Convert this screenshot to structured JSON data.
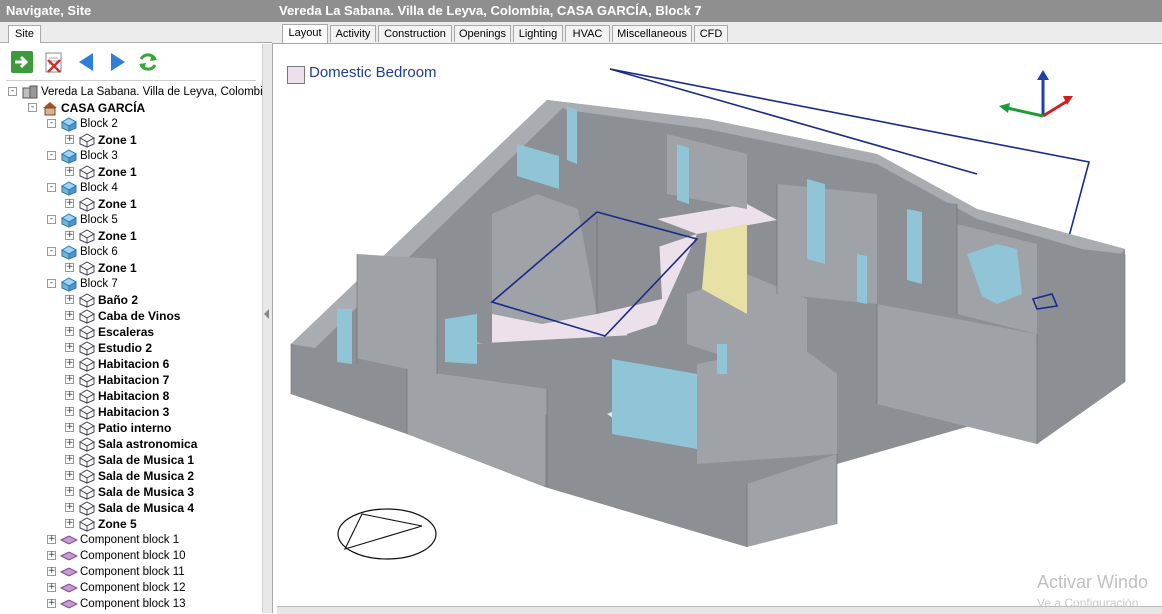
{
  "left_panel": {
    "title": "Navigate, Site",
    "tab": "Site",
    "toolbar": [
      {
        "name": "go-icon",
        "color": "#3c9a3c"
      },
      {
        "name": "delete-icon",
        "color": "#c0392b"
      },
      {
        "name": "back-arrow-icon",
        "color": "#2f7fd6"
      },
      {
        "name": "forward-arrow-icon",
        "color": "#2f7fd6"
      },
      {
        "name": "refresh-icon",
        "color": "#3aa53a"
      }
    ],
    "tree": {
      "site": "Vereda La Sabana. Villa de Leyva, Colombia",
      "building": "CASA GARCÍA",
      "blocks": [
        {
          "label": "Block 2",
          "zones": [
            "Zone 1"
          ]
        },
        {
          "label": "Block 3",
          "zones": [
            "Zone 1"
          ]
        },
        {
          "label": "Block 4",
          "zones": [
            "Zone 1"
          ]
        },
        {
          "label": "Block 5",
          "zones": [
            "Zone 1"
          ]
        },
        {
          "label": "Block 6",
          "zones": [
            "Zone 1"
          ]
        },
        {
          "label": "Block 7",
          "zones": [
            "Baño 2",
            "Caba de Vinos",
            "Escaleras",
            "Estudio 2",
            "Habitacion  6",
            "Habitacion  7",
            "Habitacion  8",
            "Habitacion 3",
            "Patio interno",
            "Sala astronomica",
            "Sala de Musica  1",
            "Sala de Musica  2",
            "Sala de Musica  3",
            "Sala de Musica  4",
            "Zone 5"
          ]
        }
      ],
      "component_blocks": [
        "Component block 1",
        "Component block 10",
        "Component block 11",
        "Component block 12",
        "Component block 13"
      ]
    }
  },
  "main": {
    "title": "Vereda La Sabana. Villa de Leyva, Colombia, CASA GARCÍA, Block 7",
    "tabs": [
      "Layout",
      "Activity",
      "Construction",
      "Openings",
      "Lighting",
      "HVAC",
      "Miscellaneous",
      "CFD"
    ],
    "active_tab": "Layout",
    "legend": {
      "label": "Domestic Bedroom",
      "color": "#ece0ea"
    },
    "watermark": {
      "line1": "Activar Windo",
      "line2": "Ve a Configuración"
    }
  },
  "colors": {
    "title_bar": "#8f8f8f",
    "wall_top": "#a9acb0",
    "wall_side": "#8c8f93",
    "glass": "#8fc5d6",
    "highlight": "#e7e1a6",
    "outline": "#1a2a8c"
  }
}
